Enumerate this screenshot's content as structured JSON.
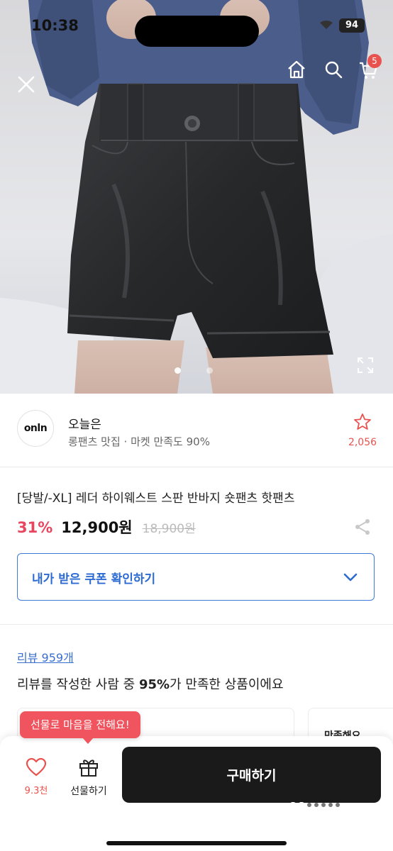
{
  "status_bar": {
    "time": "10:38",
    "battery": "94"
  },
  "hero": {
    "image_alt": "black leather high-waist shorts worn with navy long-sleeve top",
    "cart_count": "5",
    "page_dots": 2,
    "active_dot": 0
  },
  "store": {
    "logo_text": "onln",
    "name": "오늘은",
    "description": "롱팬츠 맛집 · 마켓 만족도 90%",
    "favorite_count": "2,056"
  },
  "product": {
    "title": "[당발/-XL] 레더 하이웨스트 스판 반바지 숏팬츠 핫팬츠",
    "discount": "31%",
    "price": "12,900원",
    "original_price": "18,900원"
  },
  "coupon": {
    "label": "내가 받은 쿠폰 확인하기"
  },
  "review": {
    "link_label": "리뷰 959개",
    "summary_pre": "리뷰를 작성한 사람 중 ",
    "summary_bold": "95%",
    "summary_post": "가 만족한 상품이에요",
    "card2_text": "만족해요"
  },
  "bottom_bar": {
    "gift_tooltip": "선물로 마음을 전해요!",
    "like_count": "9.3천",
    "gift_label": "선물하기",
    "buy_label": "구매하기"
  },
  "colors": {
    "accent_red": "#e8534f",
    "discount_red": "#e8455f",
    "coupon_blue": "#2d6bd2",
    "buy_button": "#1a1a1a"
  }
}
